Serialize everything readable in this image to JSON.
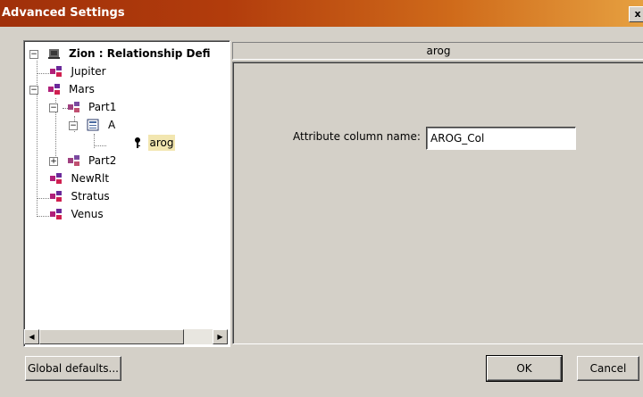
{
  "window": {
    "title": "Advanced Settings",
    "close_glyph": "x"
  },
  "tree": {
    "root": "Zion : Relationship Defi",
    "items": [
      "Jupiter",
      "Mars",
      "Part1",
      "A",
      "arog",
      "Part2",
      "NewRlt",
      "Stratus",
      "Venus"
    ],
    "selected": "arog"
  },
  "panel": {
    "header": "arog",
    "attribute_label": "Attribute column name:",
    "attribute_value": "AROG_Col"
  },
  "buttons": {
    "global_defaults": "Global defaults...",
    "ok": "OK",
    "cancel": "Cancel"
  },
  "colors": {
    "titlebar_start": "#a0300a",
    "titlebar_end": "#e6a040",
    "selection": "#f2e6b0",
    "face": "#d4d0c8"
  }
}
